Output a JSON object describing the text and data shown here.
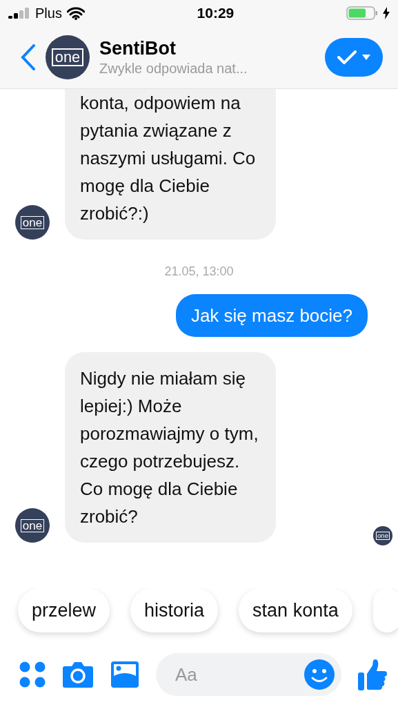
{
  "status_bar": {
    "carrier": "Plus",
    "time": "10:29",
    "charging": true
  },
  "header": {
    "title": "SentiBot",
    "subtitle": "Zwykle odpowiada nat...",
    "avatar_logo": "one"
  },
  "messages": [
    {
      "kind": "incoming",
      "text": "konta, odpowiem na pytania związane z naszymi usługami. Co mogę dla Ciebie zrobić?:)",
      "avatar_logo": "one",
      "cut_top": true
    },
    {
      "kind": "timestamp",
      "text": "21.05, 13:00"
    },
    {
      "kind": "outgoing",
      "text": "Jak się masz bocie?"
    },
    {
      "kind": "incoming",
      "text": "Nigdy nie miałam się lepiej:) Może porozmawiajmy o tym, czego potrzebujesz. Co mogę dla Ciebie zrobić?",
      "avatar_logo": "one",
      "cut_top": false
    }
  ],
  "read_receipt": {
    "avatar_logo": "one"
  },
  "quick_replies": [
    {
      "kind": "chip",
      "label": "przelew"
    },
    {
      "kind": "chip",
      "label": "historia"
    },
    {
      "kind": "chip",
      "label": "stan konta"
    },
    {
      "kind": "cut"
    }
  ],
  "composer": {
    "placeholder": "Aa"
  }
}
